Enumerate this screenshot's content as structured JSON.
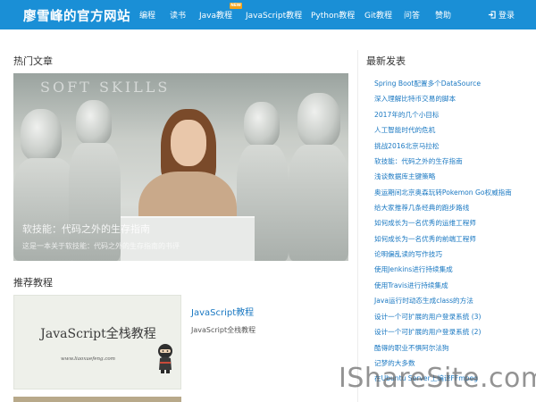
{
  "header": {
    "brand": "廖雪峰的官方网站",
    "nav": [
      {
        "label": "编程"
      },
      {
        "label": "读书"
      },
      {
        "label": "Java教程",
        "badge": "NEW"
      },
      {
        "label": "JavaScript教程"
      },
      {
        "label": "Python教程"
      },
      {
        "label": "Git教程"
      },
      {
        "label": "问答"
      },
      {
        "label": "赞助"
      }
    ],
    "login": "登录"
  },
  "hot": {
    "title": "热门文章",
    "hero": {
      "watermark": "SOFT SKILLS",
      "caption": "软技能：代码之外的生存指南",
      "sub": "这是一本关于软技能：代码之外的生存指南的书评"
    }
  },
  "recommended": {
    "title": "推荐教程",
    "thumb_title": "JavaScript全栈教程",
    "thumb_url": "www.liaoxuefeng.com",
    "link": "JavaScript教程",
    "desc": "JavaScript全栈教程"
  },
  "latest": {
    "title": "最新发表",
    "items": [
      "Spring Boot配置多个DataSource",
      "深入理解比特币交易的脚本",
      "2017年的几个小目标",
      "人工智能时代的危机",
      "挑战2016北京马拉松",
      "软技能：代码之外的生存指南",
      "浅谈数据库主键策略",
      "奥运期间北京奥森玩转Pokemon Go权威指南",
      "给大家推荐几条经典的跑步路线",
      "如何成长为一名优秀的运维工程师",
      "如何成长为一名优秀的前端工程师",
      "论明偏乱读的写作技巧",
      "使用Jenkins进行持续集成",
      "使用Travis进行持续集成",
      "Java运行时动态生成class的方法",
      "设计一个可扩展的用户登录系统 (3)",
      "设计一个可扩展的用户登录系统 (2)",
      "酷得的职业不惧阿尔法狗",
      "记梦的大多数",
      "在Ubuntu Server上编译FFmpeg"
    ]
  },
  "watermark": "IShareSite.com",
  "colors": {
    "nav_bg": "#1a8fd6",
    "link": "#1a78c2",
    "badge": "#f3a31b"
  }
}
